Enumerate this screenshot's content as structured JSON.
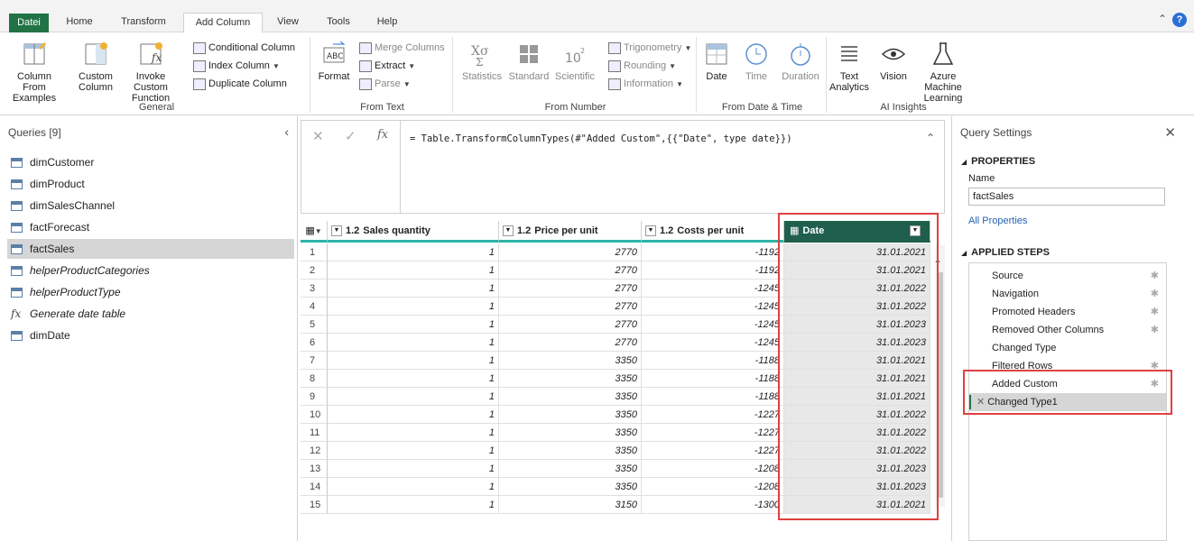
{
  "tabs": [
    "Datei",
    "Home",
    "Transform",
    "Add Column",
    "View",
    "Tools",
    "Help"
  ],
  "active_tab": "Add Column",
  "help_label": "?",
  "ribbon": {
    "general": {
      "title": "General",
      "column_from_examples": "Column From Examples",
      "custom_column": "Custom Column",
      "invoke_custom_function": "Invoke Custom Function",
      "conditional_column": "Conditional Column",
      "index_column": "Index Column",
      "duplicate_column": "Duplicate Column"
    },
    "from_text": {
      "title": "From Text",
      "format": "Format",
      "merge_columns": "Merge Columns",
      "extract": "Extract",
      "parse": "Parse"
    },
    "from_number": {
      "title": "From Number",
      "statistics": "Statistics",
      "standard": "Standard",
      "scientific": "Scientific",
      "trigonometry": "Trigonometry",
      "rounding": "Rounding",
      "information": "Information"
    },
    "from_date_time": {
      "title": "From Date & Time",
      "date": "Date",
      "time": "Time",
      "duration": "Duration"
    },
    "ai_insights": {
      "title": "AI Insights",
      "text_analytics": "Text Analytics",
      "vision": "Vision",
      "azure_ml": "Azure Machine Learning"
    }
  },
  "queries": {
    "title": "Queries [9]",
    "items": [
      {
        "label": "dimCustomer",
        "type": "table",
        "italic": false
      },
      {
        "label": "dimProduct",
        "type": "table",
        "italic": false
      },
      {
        "label": "dimSalesChannel",
        "type": "table",
        "italic": false
      },
      {
        "label": "factForecast",
        "type": "table",
        "italic": false
      },
      {
        "label": "factSales",
        "type": "table",
        "italic": false,
        "selected": true
      },
      {
        "label": "helperProductCategories",
        "type": "table",
        "italic": true
      },
      {
        "label": "helperProductType",
        "type": "table",
        "italic": true
      },
      {
        "label": "Generate date table",
        "type": "function",
        "italic": true
      },
      {
        "label": "dimDate",
        "type": "table",
        "italic": false
      }
    ]
  },
  "formula": {
    "text": "= Table.TransformColumnTypes(#\"Added Custom\",{{\"Date\", type date}})"
  },
  "grid": {
    "columns": [
      {
        "type": "1.2",
        "name": "Sales quantity"
      },
      {
        "type": "1.2",
        "name": "Price per unit"
      },
      {
        "type": "1.2",
        "name": "Costs per unit"
      },
      {
        "type": "date",
        "name": "Date"
      }
    ],
    "rows": [
      {
        "idx": "1",
        "qty": "1",
        "price": "2770",
        "cost": "-1192",
        "date": "31.01.2021"
      },
      {
        "idx": "2",
        "qty": "1",
        "price": "2770",
        "cost": "-1192",
        "date": "31.01.2021"
      },
      {
        "idx": "3",
        "qty": "1",
        "price": "2770",
        "cost": "-1245",
        "date": "31.01.2022"
      },
      {
        "idx": "4",
        "qty": "1",
        "price": "2770",
        "cost": "-1245",
        "date": "31.01.2022"
      },
      {
        "idx": "5",
        "qty": "1",
        "price": "2770",
        "cost": "-1245",
        "date": "31.01.2023"
      },
      {
        "idx": "6",
        "qty": "1",
        "price": "2770",
        "cost": "-1245",
        "date": "31.01.2023"
      },
      {
        "idx": "7",
        "qty": "1",
        "price": "3350",
        "cost": "-1188",
        "date": "31.01.2021"
      },
      {
        "idx": "8",
        "qty": "1",
        "price": "3350",
        "cost": "-1188",
        "date": "31.01.2021"
      },
      {
        "idx": "9",
        "qty": "1",
        "price": "3350",
        "cost": "-1188",
        "date": "31.01.2021"
      },
      {
        "idx": "10",
        "qty": "1",
        "price": "3350",
        "cost": "-1227",
        "date": "31.01.2022"
      },
      {
        "idx": "11",
        "qty": "1",
        "price": "3350",
        "cost": "-1227",
        "date": "31.01.2022"
      },
      {
        "idx": "12",
        "qty": "1",
        "price": "3350",
        "cost": "-1227",
        "date": "31.01.2022"
      },
      {
        "idx": "13",
        "qty": "1",
        "price": "3350",
        "cost": "-1208",
        "date": "31.01.2023"
      },
      {
        "idx": "14",
        "qty": "1",
        "price": "3350",
        "cost": "-1208",
        "date": "31.01.2023"
      },
      {
        "idx": "15",
        "qty": "1",
        "price": "3150",
        "cost": "-1300",
        "date": "31.01.2021"
      }
    ]
  },
  "settings": {
    "title": "Query Settings",
    "properties_label": "PROPERTIES",
    "name_label": "Name",
    "name_value": "factSales",
    "all_properties": "All Properties",
    "applied_steps_label": "APPLIED STEPS",
    "steps": [
      {
        "label": "Source",
        "gear": true
      },
      {
        "label": "Navigation",
        "gear": true
      },
      {
        "label": "Promoted Headers",
        "gear": true
      },
      {
        "label": "Removed Other Columns",
        "gear": true
      },
      {
        "label": "Changed Type",
        "gear": false
      },
      {
        "label": "Filtered Rows",
        "gear": true
      },
      {
        "label": "Added Custom",
        "gear": true
      },
      {
        "label": "Changed Type1",
        "gear": false,
        "selected": true
      }
    ]
  },
  "colors": {
    "accent_green": "#217346",
    "header_teal": "#2db4a6",
    "date_header": "#1f5f4c",
    "highlight_red": "#e04040"
  }
}
